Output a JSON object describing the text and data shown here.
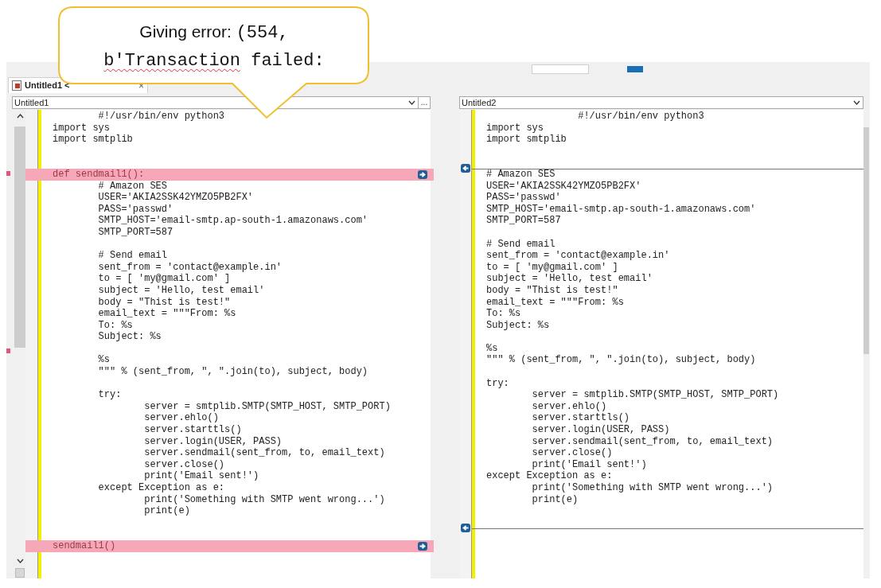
{
  "callout": {
    "lines": [
      [
        {
          "text": "Giving error: ",
          "kind": "prose",
          "misspelled": false
        },
        {
          "text": "(554,",
          "kind": "code",
          "misspelled": false
        }
      ],
      [
        {
          "text": "b'Transaction",
          "kind": "code",
          "misspelled": true
        },
        {
          "text": " failed:",
          "kind": "code",
          "misspelled": false
        }
      ]
    ]
  },
  "tab": {
    "label": "Untitled1 <",
    "close": "×"
  },
  "panes": [
    {
      "file": "Untitled1",
      "more": "...",
      "lines": [
        {
          "kind": "same",
          "text": "\t#!/usr/bin/env python3"
        },
        {
          "kind": "same",
          "text": "import sys"
        },
        {
          "kind": "same",
          "text": "import smtplib"
        },
        {
          "kind": "same"
        },
        {
          "kind": "same"
        },
        {
          "kind": "changed",
          "text": "def sendmail1():"
        },
        {
          "kind": "same",
          "text": "\t# Amazon SES"
        },
        {
          "kind": "same",
          "text": "\tUSER='AKIA2SSK42YMZO5PB2FX'"
        },
        {
          "kind": "same",
          "text": "\tPASS='passwd'"
        },
        {
          "kind": "same",
          "text": "\tSMTP_HOST='email-smtp.ap-south-1.amazonaws.com'"
        },
        {
          "kind": "same",
          "text": "\tSMTP_PORT=587"
        },
        {
          "kind": "same"
        },
        {
          "kind": "same",
          "text": "\t# Send email"
        },
        {
          "kind": "same",
          "text": "\tsent_from = 'contact@example.in'"
        },
        {
          "kind": "same",
          "text": "\tto = [ 'my@gmail.com' ]"
        },
        {
          "kind": "same",
          "text": "\tsubject = 'Hello, test email'"
        },
        {
          "kind": "same",
          "text": "\tbody = \"Thist is test!\""
        },
        {
          "kind": "same",
          "text": "\temail_text = \"\"\"From: %s"
        },
        {
          "kind": "same",
          "text": "\tTo: %s"
        },
        {
          "kind": "same",
          "text": "\tSubject: %s"
        },
        {
          "kind": "same"
        },
        {
          "kind": "same",
          "text": "\t%s"
        },
        {
          "kind": "same",
          "text": "\t\"\"\" % (sent_from, \", \".join(to), subject, body)"
        },
        {
          "kind": "same"
        },
        {
          "kind": "same",
          "text": "\ttry:"
        },
        {
          "kind": "same",
          "text": "\t\tserver = smtplib.SMTP(SMTP_HOST, SMTP_PORT)"
        },
        {
          "kind": "same",
          "text": "\t\tserver.ehlo()"
        },
        {
          "kind": "same",
          "text": "\t\tserver.starttls()"
        },
        {
          "kind": "same",
          "text": "\t\tserver.login(USER, PASS)"
        },
        {
          "kind": "same",
          "text": "\t\tserver.sendmail(sent_from, to, email_text)"
        },
        {
          "kind": "same",
          "text": "\t\tserver.close()"
        },
        {
          "kind": "same",
          "text": "\t\tprint('Email sent!')"
        },
        {
          "kind": "same",
          "text": "\texcept Exception as e:"
        },
        {
          "kind": "same",
          "text": "\t\tprint('Something with SMTP went wrong...')"
        },
        {
          "kind": "same",
          "text": "\t\tprint(e)"
        },
        {
          "kind": "same"
        },
        {
          "kind": "same"
        },
        {
          "kind": "changed",
          "text": "sendmail1()"
        }
      ]
    },
    {
      "file": "Untitled2",
      "lines": [
        {
          "kind": "same",
          "text": "\t\t#!/usr/bin/env python3"
        },
        {
          "kind": "same",
          "text": "import sys"
        },
        {
          "kind": "same",
          "text": "import smtplib"
        },
        {
          "kind": "same"
        },
        {
          "kind": "same"
        },
        {
          "kind": "gap"
        },
        {
          "kind": "same",
          "text": "# Amazon SES"
        },
        {
          "kind": "same",
          "text": "USER='AKIA2SSK42YMZO5PB2FX'"
        },
        {
          "kind": "same",
          "text": "PASS='passwd'"
        },
        {
          "kind": "same",
          "text": "SMTP_HOST='email-smtp.ap-south-1.amazonaws.com'"
        },
        {
          "kind": "same",
          "text": "SMTP_PORT=587"
        },
        {
          "kind": "same"
        },
        {
          "kind": "same",
          "text": "# Send email"
        },
        {
          "kind": "same",
          "text": "sent_from = 'contact@example.in'"
        },
        {
          "kind": "same",
          "text": "to = [ 'my@gmail.com' ]"
        },
        {
          "kind": "same",
          "text": "subject = 'Hello, test email'"
        },
        {
          "kind": "same",
          "text": "body = \"Thist is test!\""
        },
        {
          "kind": "same",
          "text": "email_text = \"\"\"From: %s"
        },
        {
          "kind": "same",
          "text": "To: %s"
        },
        {
          "kind": "same",
          "text": "Subject: %s"
        },
        {
          "kind": "same"
        },
        {
          "kind": "same",
          "text": "%s"
        },
        {
          "kind": "same",
          "text": "\"\"\" % (sent_from, \", \".join(to), subject, body)"
        },
        {
          "kind": "same"
        },
        {
          "kind": "same",
          "text": "try:"
        },
        {
          "kind": "same",
          "text": "\tserver = smtplib.SMTP(SMTP_HOST, SMTP_PORT)"
        },
        {
          "kind": "same",
          "text": "\tserver.ehlo()"
        },
        {
          "kind": "same",
          "text": "\tserver.starttls()"
        },
        {
          "kind": "same",
          "text": "\tserver.login(USER, PASS)"
        },
        {
          "kind": "same",
          "text": "\tserver.sendmail(sent_from, to, email_text)"
        },
        {
          "kind": "same",
          "text": "\tserver.close()"
        },
        {
          "kind": "same",
          "text": "\tprint('Email sent!')"
        },
        {
          "kind": "same",
          "text": "except Exception as e:"
        },
        {
          "kind": "same",
          "text": "\tprint('Something with SMTP went wrong...')"
        },
        {
          "kind": "same",
          "text": "\tprint(e)"
        },
        {
          "kind": "same"
        },
        {
          "kind": "same"
        },
        {
          "kind": "gap"
        }
      ]
    }
  ]
}
